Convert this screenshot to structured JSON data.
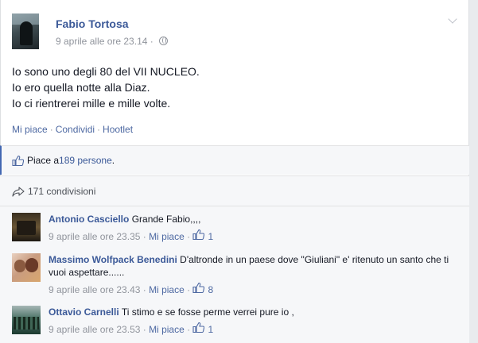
{
  "post": {
    "author": "Fabio Tortosa",
    "timestamp": "9 aprile alle ore 23.14",
    "separator": "·",
    "lines": [
      "Io sono uno degli 80 del VII NUCLEO.",
      "Io ero quella notte alla Diaz.",
      "Io ci rientrerei mille e mille volte."
    ],
    "actions": [
      "Mi piace",
      "Condividi",
      "Hootlet"
    ],
    "dot": "·"
  },
  "likes": {
    "prefix": "Piace a ",
    "count": "189 persone",
    "suffix": "."
  },
  "shares": {
    "label": "171 condivisioni"
  },
  "comments": [
    {
      "name": "Antonio Casciello",
      "text": "Grande Fabio,,,,",
      "timestamp": "9 aprile alle ore 23.35",
      "like_label": "Mi piace",
      "like_count": "1"
    },
    {
      "name": "Massimo Wolfpack Benedini",
      "text": "D'altronde in un paese dove \"Giuliani\" e' ritenuto un santo che ti vuoi aspettare......",
      "timestamp": "9 aprile alle ore 23.43",
      "like_label": "Mi piace",
      "like_count": "8"
    },
    {
      "name": "Ottavio Carnelli",
      "text": "Ti stimo e se fosse perme verrei pure io ,",
      "timestamp": "9 aprile alle ore 23.53",
      "like_label": "Mi piace",
      "like_count": "1"
    }
  ],
  "colors": {
    "link": "#3b5998",
    "meta": "#90949c",
    "band": "#f6f7f9"
  },
  "icons": [
    "globe-icon",
    "chevron-down-icon",
    "thumbs-up-icon",
    "share-arrow-icon"
  ]
}
